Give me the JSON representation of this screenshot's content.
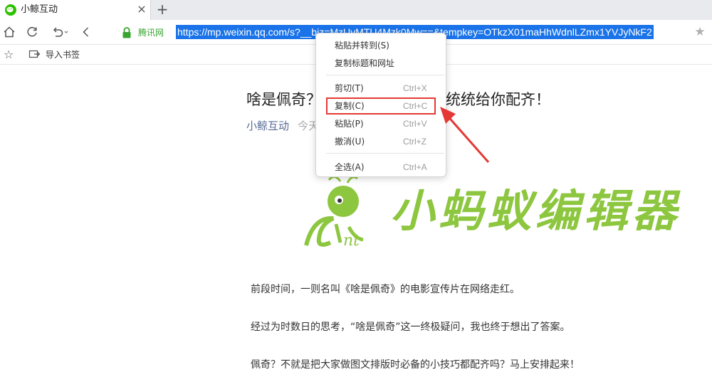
{
  "browser": {
    "tab": {
      "title": "小鲸互动",
      "close_glyph": "×",
      "favicon": "wechat-icon"
    },
    "new_tab_glyph": "+",
    "address": {
      "site_label": "腾讯网",
      "url": "https://mp.weixin.qq.com/s?__biz=MzUyMTU4Mzk0Mw==&tempkey=OTkzX01maHhWdnlLZmx1YVJyNkF2"
    },
    "bookmarks": {
      "import_label": "导入书签"
    }
  },
  "article": {
    "title_head": "啥是佩奇？",
    "title_tail": "统统给你配齐！",
    "author": "小鲸互动",
    "date": "今天",
    "logo_text": "小蚂蚁编辑器",
    "paragraphs": [
      "前段时间，一则名叫《啥是佩奇》的电影宣传片在网络走红。",
      "经过为时数日的思考，“啥是佩奇”这一终极疑问，我也终于想出了答案。",
      "佩奇？不就是把大家做图文排版时必备的小技巧都配齐吗？马上安排起来！"
    ]
  },
  "context_menu": {
    "items": [
      {
        "label": "粘贴并转到(S)",
        "shortcut": ""
      },
      {
        "label": "复制标题和网址",
        "shortcut": ""
      },
      {
        "label": "剪切(T)",
        "shortcut": "Ctrl+X"
      },
      {
        "label": "复制(C)",
        "shortcut": "Ctrl+C"
      },
      {
        "label": "粘贴(P)",
        "shortcut": "Ctrl+V"
      },
      {
        "label": "撤消(U)",
        "shortcut": "Ctrl+Z"
      },
      {
        "label": "全选(A)",
        "shortcut": "Ctrl+A"
      }
    ]
  },
  "colors": {
    "url_highlight": "#1a73e8",
    "site_green": "#3aa430",
    "annotation_red": "#e53935",
    "logo_green": "#8dc63f",
    "author_blue": "#576b95"
  }
}
